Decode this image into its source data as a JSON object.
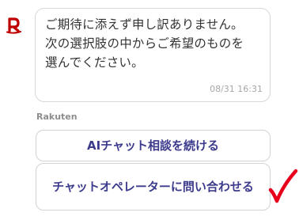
{
  "chat": {
    "bot_message": "ご期待に添えず申し訳ありません。\n次の選択肢の中からご希望のものを\n選んでください。",
    "timestamp": "08/31 16:31",
    "sender_label": "Rakuten"
  },
  "options": {
    "ai_chat_label": "AIチャット相談を続ける",
    "operator_label": "チャットオペレーターに問い合わせる"
  },
  "colors": {
    "brand": "#bf0000",
    "button_text": "#3c3b8c",
    "annotation": "#e8001c"
  },
  "icons": {
    "avatar": "rakuten-r-logo",
    "annotation": "red-checkmark"
  }
}
